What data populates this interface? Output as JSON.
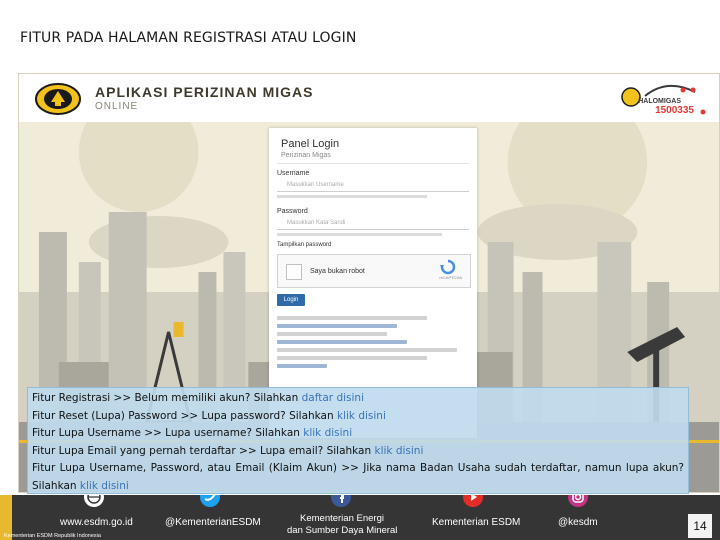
{
  "slide": {
    "title": "FITUR PADA HALAMAN REGISTRASI ATAU LOGIN"
  },
  "app": {
    "title": "APLIKASI PERIZINAN MIGAS",
    "subtitle": "ONLINE",
    "hotline_label": "HALOMIGAS",
    "hotline_number": "1500335"
  },
  "panel": {
    "title": "Panel Login",
    "subtitle": "Perizinan Migas",
    "username_label": "Username",
    "username_placeholder": "Masukkan Username",
    "password_label": "Password",
    "password_placeholder": "Masukkan Kata Sandi",
    "show_password": "Tampilkan password",
    "captcha_text": "Saya bukan robot",
    "captcha_brand": "reCAPTCHA",
    "login_button": "Login"
  },
  "overlay": {
    "lines": [
      {
        "text": "Fitur Registrasi >> Belum memiliki akun? Silahkan ",
        "link": "daftar disini"
      },
      {
        "text": "Fitur Reset (Lupa) Password >> Lupa password? Silahkan ",
        "link": "klik disini"
      },
      {
        "text": "Fitur Lupa Username >> Lupa username? Silahkan ",
        "link": "klik disini"
      },
      {
        "text": "Fitur Lupa Email yang pernah terdaftar >> Lupa email? Silahkan ",
        "link": "klik disini"
      },
      {
        "text": "Fitur Lupa Username, Password, atau Email (Klaim Akun) >> Jika nama Badan Usaha sudah terdaftar, namun lupa akun? Silahkan ",
        "link": "klik disini"
      }
    ]
  },
  "footer": {
    "website": "www.esdm.go.id",
    "twitter": "@KementerianESDM",
    "org_line1": "Kementerian Energi",
    "org_line2": "dan Sumber Daya Mineral",
    "youtube": "Kementerian ESDM",
    "instagram": "@kesdm",
    "copyright": "Kementerian ESDM Republik Indonesia",
    "page_number": "14"
  },
  "colors": {
    "link": "#3a72b8",
    "overlay_bg": "#bfdbee",
    "footer_bg": "#353535",
    "accent": "#e8b92e",
    "hotline": "#e53935",
    "login_button": "#2f6ba8"
  }
}
